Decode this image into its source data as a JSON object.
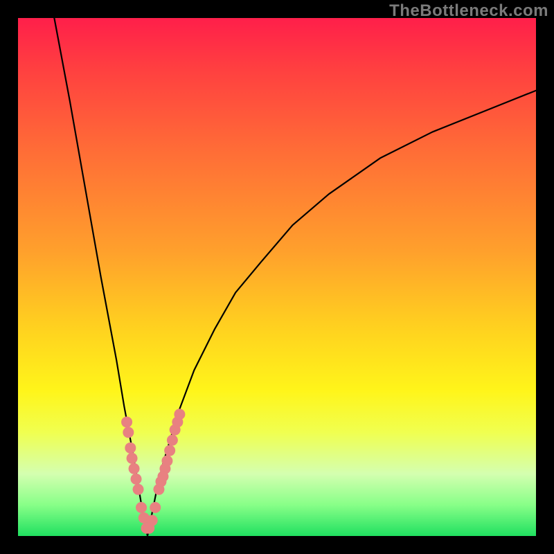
{
  "watermark": "TheBottleneck.com",
  "chart_data": {
    "type": "line",
    "title": "",
    "xlabel": "",
    "ylabel": "",
    "xlim": [
      0,
      100
    ],
    "ylim": [
      0,
      100
    ],
    "curve_minimum_x": 25,
    "curve_description": "V-shaped bottleneck curve; value reaches 100 at x≈7 on the left tail, drops sharply to ≈0 at x≈25, rises logarithmically toward ≈86 at x=100",
    "series": [
      {
        "name": "bottleneck-curve",
        "x": [
          7,
          10,
          13,
          16,
          19,
          20.5,
          22,
          23,
          24,
          25,
          26,
          27,
          28,
          29.5,
          31,
          34,
          38,
          42,
          47,
          53,
          60,
          70,
          80,
          90,
          100
        ],
        "y": [
          100,
          84,
          67,
          50,
          34,
          25,
          17,
          11,
          5,
          0,
          5,
          10,
          14,
          19,
          24,
          32,
          40,
          47,
          53,
          60,
          66,
          73,
          78,
          82,
          86
        ]
      }
    ],
    "markers": {
      "description": "Pink dot clusters along the lower part of both branches near the trough",
      "points": [
        {
          "x": 21.0,
          "y": 22.0
        },
        {
          "x": 21.3,
          "y": 20.0
        },
        {
          "x": 21.7,
          "y": 17.0
        },
        {
          "x": 22.0,
          "y": 15.0
        },
        {
          "x": 22.4,
          "y": 13.0
        },
        {
          "x": 22.8,
          "y": 11.0
        },
        {
          "x": 23.2,
          "y": 9.0
        },
        {
          "x": 23.8,
          "y": 5.5
        },
        {
          "x": 24.3,
          "y": 3.5
        },
        {
          "x": 24.8,
          "y": 1.5
        },
        {
          "x": 25.3,
          "y": 1.5
        },
        {
          "x": 25.9,
          "y": 3.0
        },
        {
          "x": 26.5,
          "y": 5.5
        },
        {
          "x": 27.2,
          "y": 9.0
        },
        {
          "x": 28.4,
          "y": 13.0
        },
        {
          "x": 28.8,
          "y": 14.5
        },
        {
          "x": 29.3,
          "y": 16.5
        },
        {
          "x": 29.8,
          "y": 18.5
        },
        {
          "x": 30.3,
          "y": 20.5
        },
        {
          "x": 30.8,
          "y": 22.0
        },
        {
          "x": 31.2,
          "y": 23.5
        },
        {
          "x": 27.6,
          "y": 10.5
        },
        {
          "x": 28.0,
          "y": 11.5
        }
      ],
      "color": "#e88181",
      "radius_px": 8
    }
  }
}
